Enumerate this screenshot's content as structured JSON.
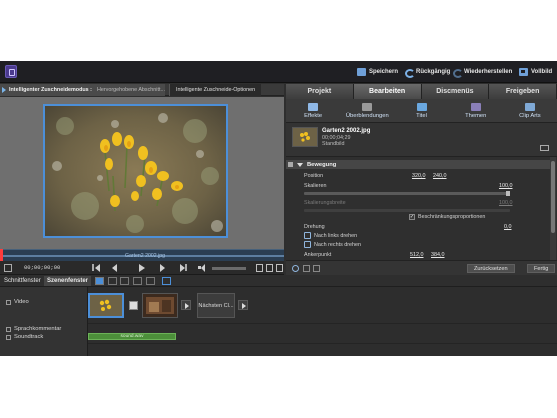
{
  "topbar": {
    "save": "Speichern",
    "undo": "Rückgängig",
    "redo": "Wiederherstellen",
    "fullscreen": "Vollbild"
  },
  "monitor": {
    "mode_label": "Intelligenter Zuschneidemodus :",
    "mode_sub": "Hervorgehobene Abschnitt...",
    "options_tab": "Intelligente Zuschneide-Optionen",
    "scrub_clip_name": "Garten2 2002.jpg",
    "timecode": "00;00;00;00"
  },
  "right_panel": {
    "tabs": [
      "Projekt",
      "Bearbeiten",
      "Discmenüs",
      "Freigeben"
    ],
    "active_tab": 1,
    "subtools": [
      {
        "label": "Effekte",
        "icon": "effects-icon",
        "color": "#8fb8e6"
      },
      {
        "label": "Überblendungen",
        "icon": "transitions-icon",
        "color": "#9a9a9a"
      },
      {
        "label": "Titel",
        "icon": "titles-icon",
        "color": "#6aa8e0"
      },
      {
        "label": "Themen",
        "icon": "themes-icon",
        "color": "#8a7fb8"
      },
      {
        "label": "Clip Arts",
        "icon": "clip-arts-icon",
        "color": "#7fa9d6"
      }
    ],
    "clip": {
      "name": "Garten2 2002.jpg",
      "duration": "00;00;04;29",
      "type": "Standbild"
    },
    "section": "Bewegung",
    "props": {
      "position_label": "Position",
      "position_x": "320,0",
      "position_y": "240,0",
      "scale_label": "Skalieren",
      "scale_value": "100,0",
      "scale_fraction": 1.0,
      "scale_width_label": "Skalierungsbreite",
      "scale_width_value": "100,0",
      "keep_ratio_label": "Beschränkungsproportionen",
      "keep_ratio_checked": true,
      "rotation_label": "Drehung",
      "rotation_value": "0,0",
      "rotate_left": "Nach links drehen",
      "rotate_right": "Nach rechts drehen",
      "anchor_label": "Ankerpunkt",
      "anchor_x": "512,0",
      "anchor_y": "384,0"
    },
    "footer": {
      "reset": "Zurücksetzen",
      "done": "Fertig"
    }
  },
  "timeline": {
    "tabs": [
      "Schnittfenster",
      "Szenenfenster"
    ],
    "active_tab": 1,
    "tracks": {
      "video": "Video",
      "narration": "Sprachkommentar",
      "soundtrack": "Soundtrack"
    },
    "next_clip_label": "Nächsten Cl...",
    "audio_clip": "sound.wav"
  },
  "colors": {
    "accent": "#4c8fd8",
    "panel": "#2e2e2e",
    "topbar": "#1f1f23",
    "audio": "#4c8f3a"
  }
}
